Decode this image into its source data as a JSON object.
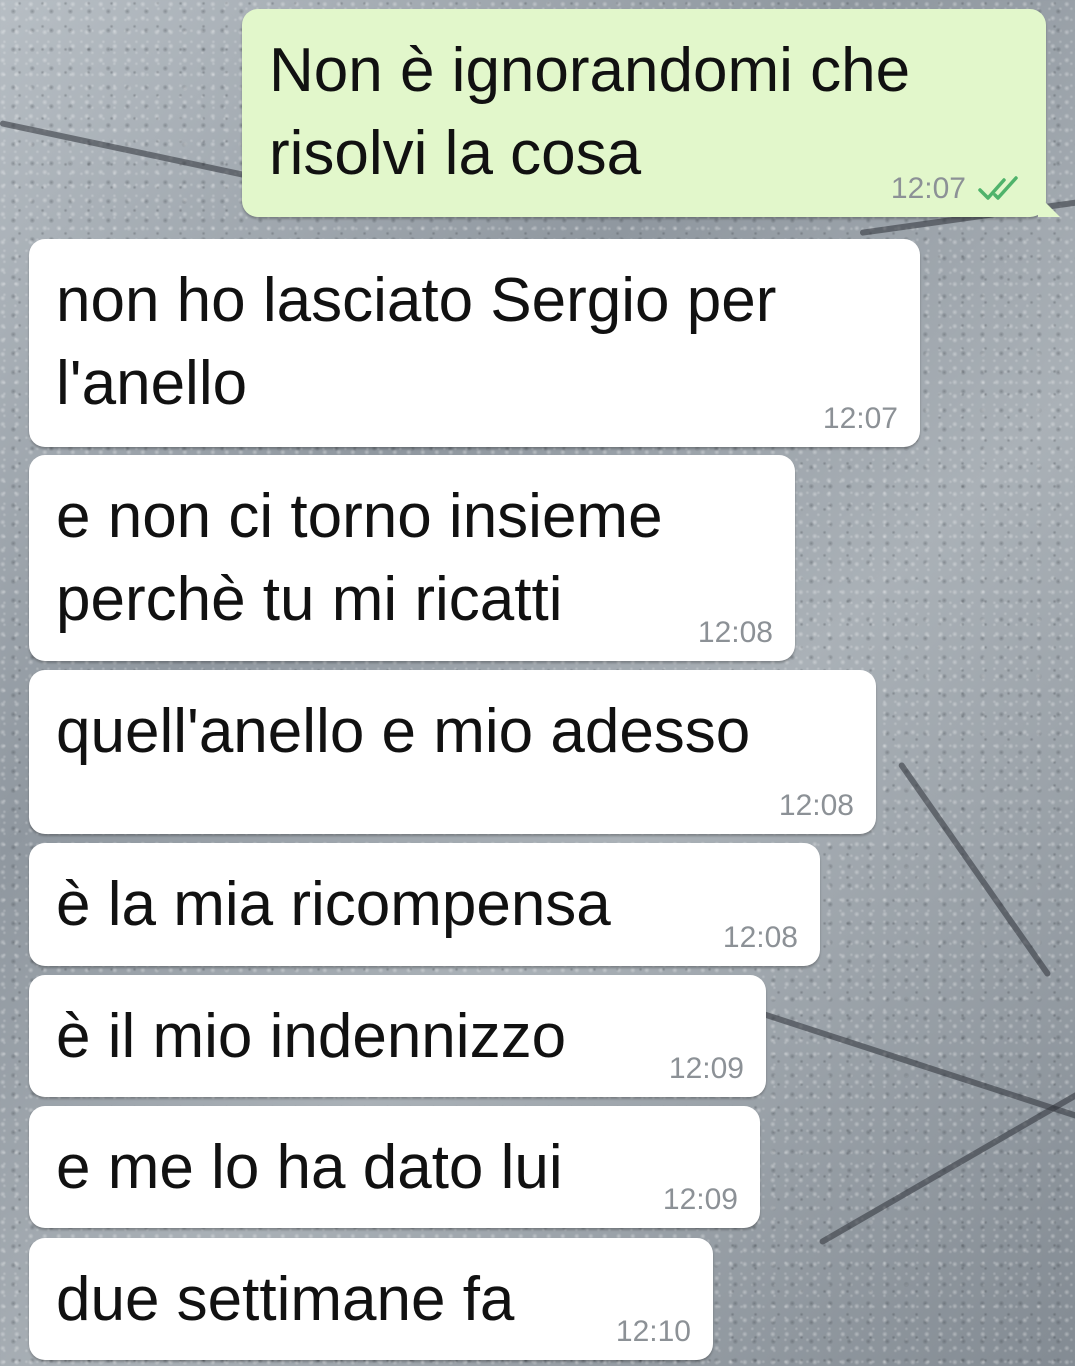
{
  "messages": [
    {
      "direction": "out",
      "text": "Non è ignorandomi che\nrisolvi la cosa",
      "time": "12:07",
      "status_icon": "double-check-icon"
    },
    {
      "direction": "in",
      "text": "non ho lasciato Sergio per\nl'anello",
      "time": "12:07"
    },
    {
      "direction": "in",
      "text": "e non ci torno insieme\nperchè tu mi ricatti",
      "time": "12:08"
    },
    {
      "direction": "in",
      "text": "quell'anello e mio adesso",
      "time": "12:08"
    },
    {
      "direction": "in",
      "text": "è la mia ricompensa",
      "time": "12:08"
    },
    {
      "direction": "in",
      "text": "è il mio indennizzo",
      "time": "12:09"
    },
    {
      "direction": "in",
      "text": "e me lo ha dato lui",
      "time": "12:09"
    },
    {
      "direction": "in",
      "text": "due settimane fa",
      "time": "12:10"
    }
  ],
  "colors": {
    "outgoing_bubble": "#e2f7cb",
    "incoming_bubble": "#ffffff",
    "timestamp": "#8c9196",
    "read_check": "#4fb36b"
  }
}
